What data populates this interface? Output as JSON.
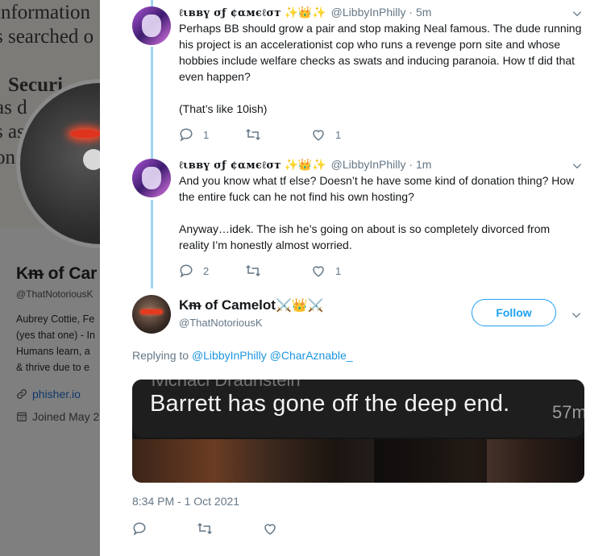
{
  "background_profile": {
    "doc_lines": [
      "information",
      "s searched o",
      "Securi",
      "as d",
      "s as",
      "on"
    ],
    "display_name": "Kᵯ of Car",
    "handle": "@ThatNotoriousK",
    "bio_lines": [
      "Aubrey Cottie, Fe",
      "(yes that one) - In",
      "Humans learn, a",
      "& thrive due to e"
    ],
    "link": "phisher.io",
    "joined": "Joined May 2"
  },
  "thread": [
    {
      "display_name": "ℓιввү σƒ ¢αмєℓσт",
      "emoji": "✨👑✨",
      "handle": "@LibbyInPhilly",
      "time": "5m",
      "body_paragraphs": [
        "Perhaps BB should grow a pair and stop making Neal famous. The dude running his project is an accelerationist cop who runs a revenge porn site and whose hobbies include welfare checks as swats and inducing paranoia. How tf did that even happen?",
        "(That’s like 10ish)"
      ],
      "reply_count": "1",
      "like_count": "1"
    },
    {
      "display_name": "ℓιввү σƒ ¢αмєℓσт",
      "emoji": "✨👑✨",
      "handle": "@LibbyInPhilly",
      "time": "1m",
      "body_paragraphs": [
        "And you know what tf else? Doesn’t he have some kind of donation thing? How the entire fuck can he not find his own hosting?",
        "Anyway…idek. The ish he’s going on about is so completely divorced from reality I’m honestly almost worried."
      ],
      "reply_count": "2",
      "like_count": "1"
    }
  ],
  "focused_tweet": {
    "display_name": "Kᵯ of Camelot",
    "emoji": "⚔️👑⚔️",
    "handle": "@ThatNotoriousK",
    "follow_label": "Follow",
    "replying_prefix": "Replying to",
    "replying_to": [
      "@LibbyInPhilly",
      "@CharAznable_"
    ],
    "media": {
      "ghost_text": "ivicnaci Draunstein",
      "caption": "Barrett has gone off the deep end.",
      "stamp": "57m"
    },
    "timestamp": "8:34 PM - 1 Oct 2021"
  },
  "colors": {
    "accent": "#1da1f2",
    "thread_line": "#9fd4f0",
    "secondary_text": "#657786",
    "overlay": "#7f7f7f"
  }
}
